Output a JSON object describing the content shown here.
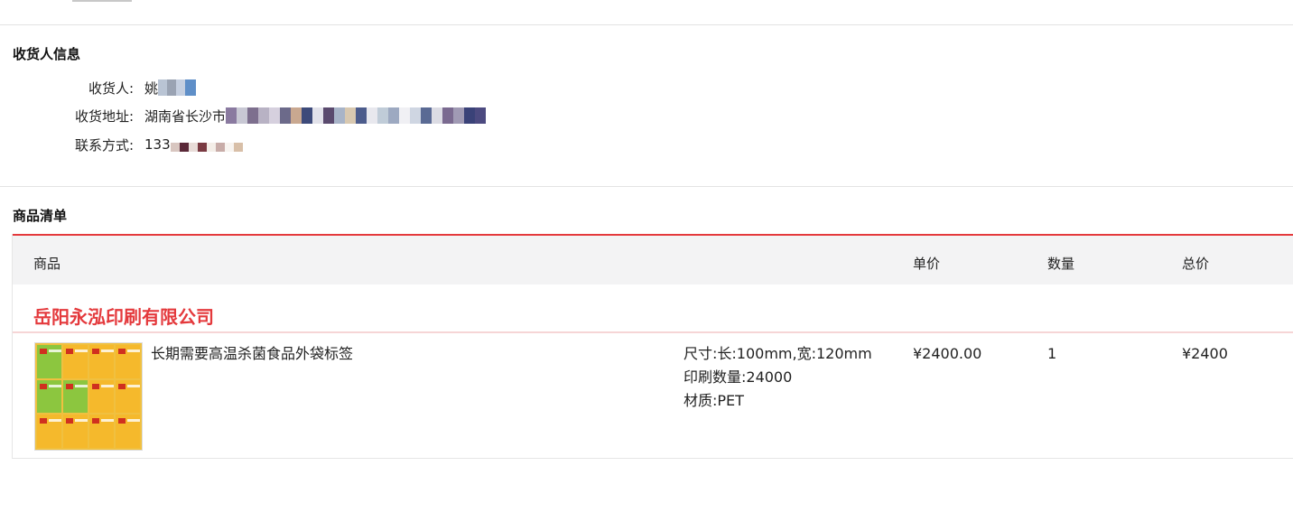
{
  "consignee": {
    "section_title": "收货人信息",
    "name_label": "收货人:",
    "name_value": "姚",
    "address_label": "收货地址:",
    "address_value": "湖南省长沙市",
    "phone_label": "联系方式:",
    "phone_value": "133"
  },
  "products": {
    "section_title": "商品清单",
    "columns": [
      "商品",
      "单价",
      "数量",
      "总价"
    ],
    "shop_name": "岳阳永泓印刷有限公司",
    "items": [
      {
        "name": "长期需要高温杀菌食品外袋标签",
        "specs": [
          "尺寸:长:100mm,宽:120mm",
          "印刷数量:24000",
          "材质:PET"
        ],
        "unit_price": "¥2400.00",
        "quantity": "1",
        "total": "¥2400"
      }
    ]
  },
  "colors": {
    "accent": "#e4393c",
    "header_bg": "#f3f3f4"
  }
}
